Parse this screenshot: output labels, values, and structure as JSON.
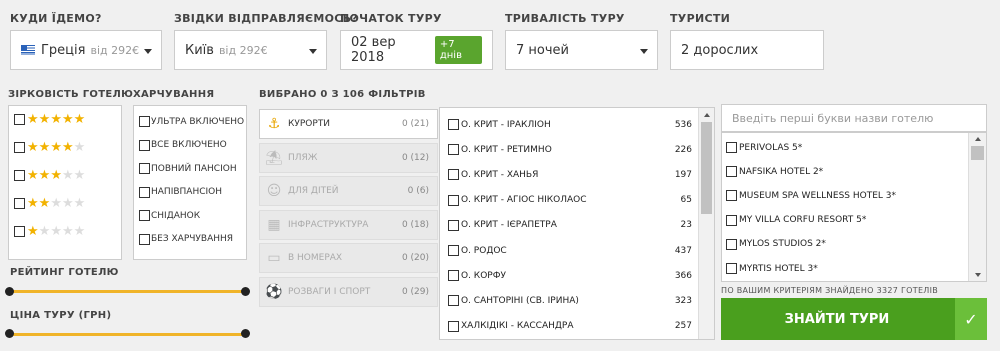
{
  "search": {
    "destination": {
      "label": "КУДИ ЇДЕМО?",
      "value": "Греція",
      "price": "від 292€"
    },
    "departure": {
      "label": "ЗВІДКИ ВІДПРАВЛЯЄМОСЬ?",
      "value": "Київ",
      "price": "від 292€"
    },
    "start": {
      "label": "ПОЧАТОК ТУРУ",
      "value": "02 вер 2018",
      "badge": "+7 днів"
    },
    "duration": {
      "label": "ТРИВАЛІСТЬ ТУРУ",
      "value": "7 ночей"
    },
    "tourists": {
      "label": "ТУРИСТИ",
      "value": "2 дорослих"
    }
  },
  "filters": {
    "stars_label": "ЗІРКОВІСТЬ ГОТЕЛЮ",
    "stars": [
      5,
      4,
      3,
      2,
      1
    ],
    "meals_label": "ХАРЧУВАННЯ",
    "meals": [
      "ультра включено",
      "все включено",
      "повний пансіон",
      "напівпансіон",
      "сніданок",
      "без харчування"
    ],
    "rating_label": "РЕЙТИНГ ГОТЕЛЮ",
    "price_label": "ЦІНА ТУРУ (ГРН)",
    "selected_text": "ВИБРАНО 0 З 106 ФІЛЬТРІВ",
    "categories": [
      {
        "icon": "anchor-icon",
        "glyph": "⚓",
        "label": "курорти",
        "count": "0 (21)"
      },
      {
        "icon": "beach-icon",
        "glyph": "⛱",
        "label": "пляж",
        "count": "0 (12)"
      },
      {
        "icon": "kids-icon",
        "glyph": "☺",
        "label": "для дітей",
        "count": "0 (6)"
      },
      {
        "icon": "building-icon",
        "glyph": "▦",
        "label": "інфраструктура",
        "count": "0 (18)"
      },
      {
        "icon": "bed-icon",
        "glyph": "▭",
        "label": "в номерах",
        "count": "0 (20)"
      },
      {
        "icon": "sport-icon",
        "glyph": "⚽",
        "label": "розваги і спорт",
        "count": "0 (29)"
      }
    ],
    "resorts": [
      {
        "name": "о. Крит - Іракліон",
        "count": "536"
      },
      {
        "name": "о. Крит - Ретимно",
        "count": "226"
      },
      {
        "name": "о. Крит - Ханья",
        "count": "197"
      },
      {
        "name": "о. Крит - Агіос Ніколаос",
        "count": "65"
      },
      {
        "name": "о. Крит - Ієрапетра",
        "count": "23"
      },
      {
        "name": "о. Родос",
        "count": "437"
      },
      {
        "name": "о. Корфу",
        "count": "366"
      },
      {
        "name": "о. Санторіні (Св. Ірина)",
        "count": "323"
      },
      {
        "name": "Халкідікі - Кассандра",
        "count": "257"
      }
    ]
  },
  "hotels": {
    "placeholder": "Введіть перші букви назви готелю",
    "items": [
      "Perivolas 5*",
      "Nafsika Hotel 2*",
      "Museum Spa Wellness Hotel 3*",
      "My Villa Corfu Resort 5*",
      "Mylos Studios 2*",
      "Myrtis Hotel 3*"
    ],
    "found_text": "ПО ВАШИМ КРИТЕРІЯМ ЗНАЙДЕНО 3327 ГОТЕЛІВ",
    "find_button": "ЗНАЙТИ ТУРИ"
  },
  "colors": {
    "accent": "#4a9f1e",
    "slider": "#f0b429",
    "star": "#f2b200",
    "badge": "#5aa52e"
  }
}
